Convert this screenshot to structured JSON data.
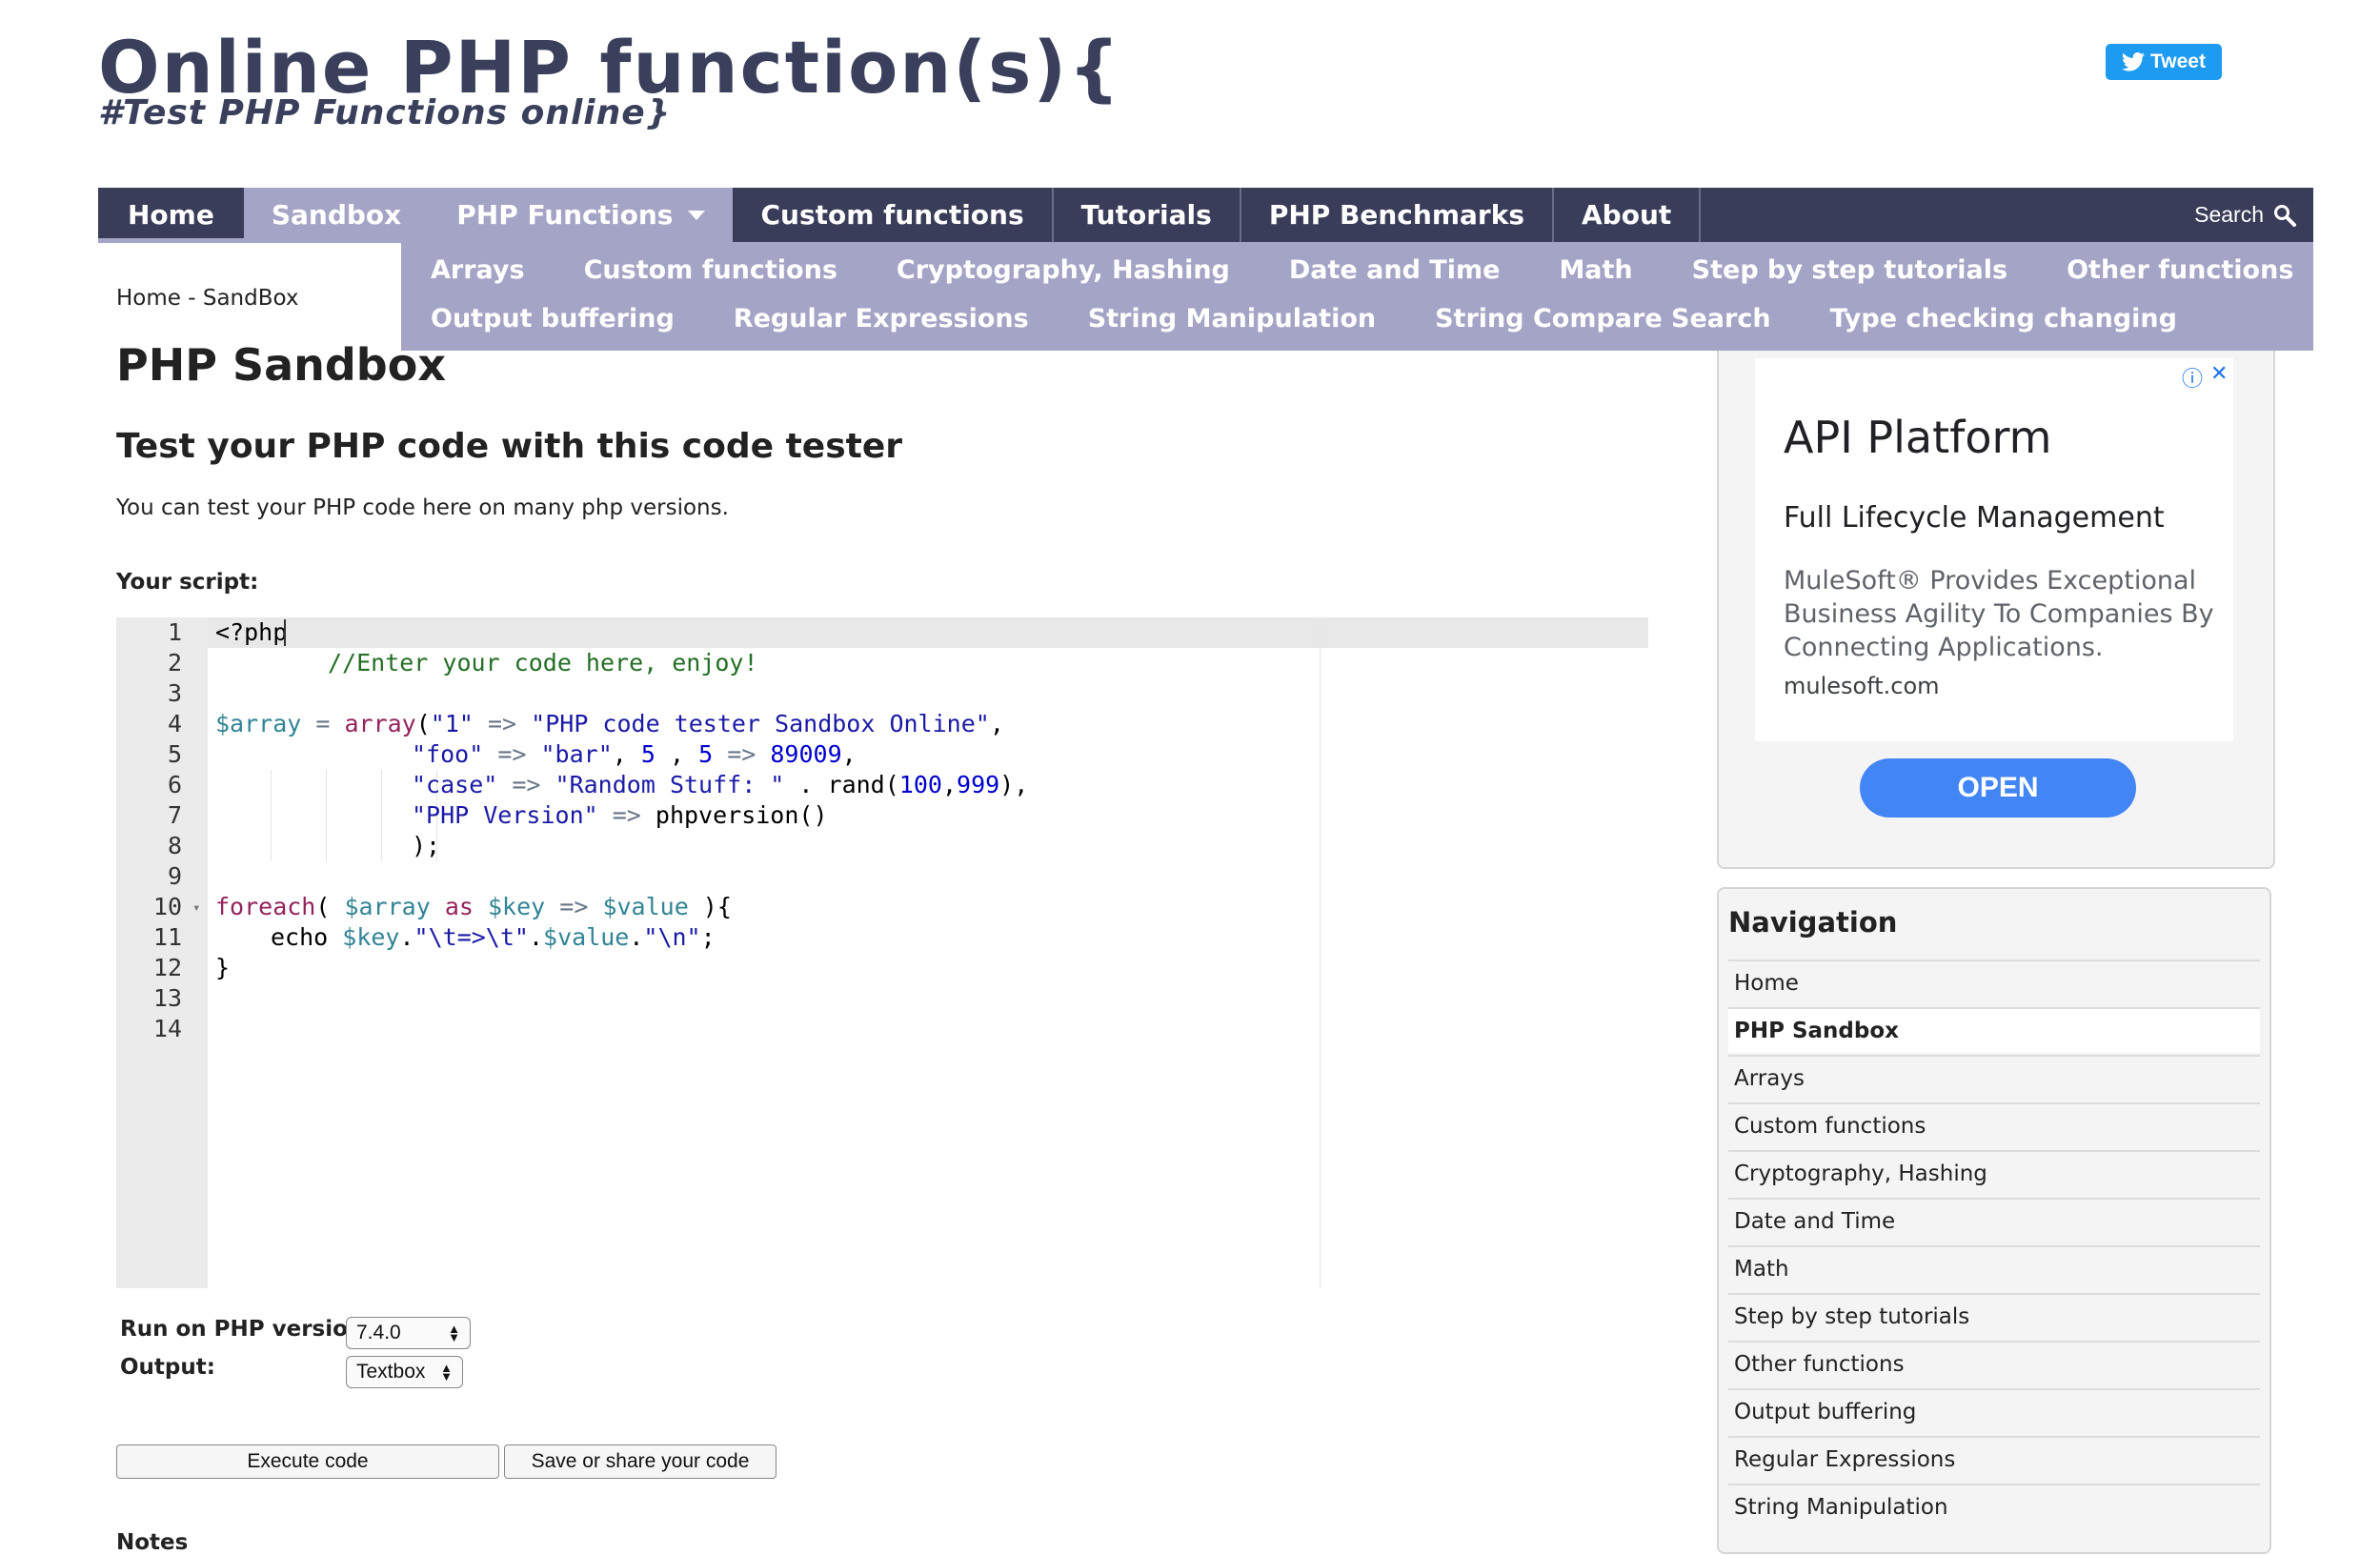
{
  "header": {
    "logo_title": "Online PHP function(s){",
    "logo_subtitle": "#Test PHP Functions online}",
    "tweet_label": "Tweet"
  },
  "nav": {
    "items": [
      {
        "label": "Home"
      },
      {
        "label": "Sandbox"
      },
      {
        "label": "PHP Functions"
      },
      {
        "label": "Custom functions"
      },
      {
        "label": "Tutorials"
      },
      {
        "label": "PHP Benchmarks"
      },
      {
        "label": "About"
      }
    ],
    "search_label": "Search"
  },
  "submenu": {
    "row1": [
      "Arrays",
      "Custom functions",
      "Cryptography, Hashing",
      "Date and Time",
      "Math",
      "Step by step tutorials",
      "Other functions"
    ],
    "row2": [
      "Output buffering",
      "Regular Expressions",
      "String Manipulation",
      "String Compare Search",
      "Type checking changing"
    ]
  },
  "content": {
    "breadcrumb": "Home - SandBox",
    "page_title": "PHP Sandbox",
    "subtitle": "Test your PHP code with this code tester",
    "intro": "You can test your PHP code here on many php versions.",
    "script_label": "Your script:"
  },
  "editor": {
    "line_numbers": [
      "1",
      "2",
      "3",
      "4",
      "5",
      "6",
      "7",
      "8",
      "9",
      "10",
      "11",
      "12",
      "13",
      "14"
    ],
    "line1": "<?php",
    "line2": "//Enter your code here, enjoy!",
    "line3": "",
    "line4": [
      "$array",
      " = ",
      "array",
      "(",
      "\"1\"",
      " => ",
      "\"PHP code tester Sandbox Online\"",
      ","
    ],
    "line5": [
      "\"foo\"",
      " => ",
      "\"bar\"",
      ", ",
      "5",
      " , ",
      "5",
      " => ",
      "89009",
      ","
    ],
    "line6": [
      "\"case\"",
      " => ",
      "\"Random Stuff: \"",
      " . ",
      "rand",
      "(",
      "100",
      ",",
      "999",
      "),"
    ],
    "line7": [
      "\"PHP Version\"",
      " => ",
      "phpversion",
      "()"
    ],
    "line8": ");",
    "line9": "",
    "line10": [
      "foreach",
      "( ",
      "$array",
      " as ",
      "$key",
      " => ",
      "$value",
      " ){"
    ],
    "line11": [
      "echo ",
      "$key",
      ".",
      "\"\\t=>\\t\"",
      ".",
      "$value",
      ".",
      "\"\\n\"",
      ";"
    ],
    "line12": "}",
    "line13": "",
    "line14": ""
  },
  "controls": {
    "run_label": "Run on PHP version:",
    "php_version": "7.4.0",
    "output_label": "Output:",
    "output_mode": "Textbox",
    "execute_label": "Execute code",
    "save_label": "Save or share your code",
    "notes_stub": "Notes"
  },
  "ad": {
    "title": "API Platform",
    "subtitle": "Full Lifecycle Management",
    "body": "MuleSoft® Provides Exceptional Business Agility To Companies By Connecting Applications.",
    "url": "mulesoft.com",
    "open_label": "OPEN"
  },
  "sidenav": {
    "title": "Navigation",
    "items": [
      "Home",
      "PHP Sandbox",
      "Arrays",
      "Custom functions",
      "Cryptography, Hashing",
      "Date and Time",
      "Math",
      "Step by step tutorials",
      "Other functions",
      "Output buffering",
      "Regular Expressions",
      "String Manipulation"
    ],
    "current": "PHP Sandbox"
  },
  "colors": {
    "nav_bg": "#3a3d59",
    "nav_active": "#a4a4c6",
    "logo": "#3a3f5c",
    "tweet": "#1d9bf0",
    "ad_button": "#4285f4"
  }
}
